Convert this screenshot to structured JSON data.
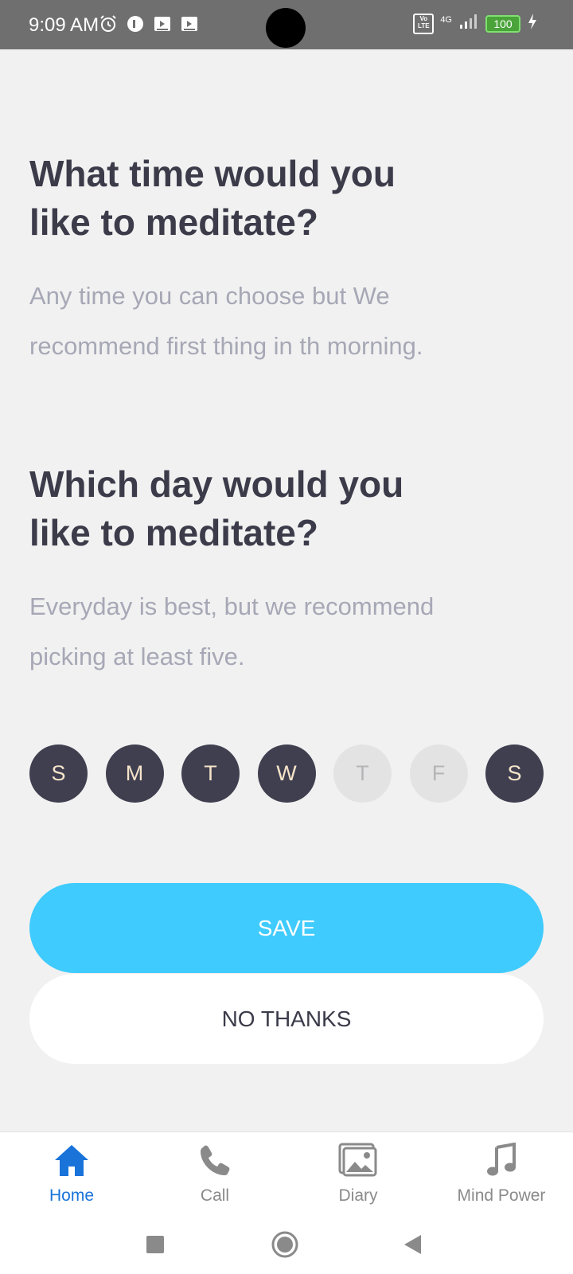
{
  "status_bar": {
    "time": "9:09 AM",
    "network": "4G",
    "volte": "Vo LTE",
    "battery": "100"
  },
  "time_section": {
    "title_line1": "What time would you",
    "title_line2": "like to meditate?",
    "subtitle_line1": "Any time you can choose but We",
    "subtitle_line2": "recommend first thing in th morning."
  },
  "day_section": {
    "title_line1": "Which day would you",
    "title_line2": "like to meditate?",
    "subtitle_line1": "Everyday is best, but we recommend",
    "subtitle_line2": "picking at least five."
  },
  "days": [
    {
      "label": "S",
      "selected": true
    },
    {
      "label": "M",
      "selected": true
    },
    {
      "label": "T",
      "selected": true
    },
    {
      "label": "W",
      "selected": true
    },
    {
      "label": "T",
      "selected": false
    },
    {
      "label": "F",
      "selected": false
    },
    {
      "label": "S",
      "selected": true
    }
  ],
  "buttons": {
    "save": "SAVE",
    "no_thanks": "NO THANKS"
  },
  "tabs": [
    {
      "label": "Home",
      "icon": "home-icon",
      "active": true
    },
    {
      "label": "Call",
      "icon": "phone-icon",
      "active": false
    },
    {
      "label": "Diary",
      "icon": "gallery-icon",
      "active": false
    },
    {
      "label": "Mind Power",
      "icon": "music-note-icon",
      "active": false
    }
  ],
  "colors": {
    "accent": "#3fcbfd",
    "day_selected": "#3f3f50",
    "tab_active": "#1a73d9",
    "heading": "#3b3b4a",
    "subtitle": "#a7a8b6"
  }
}
